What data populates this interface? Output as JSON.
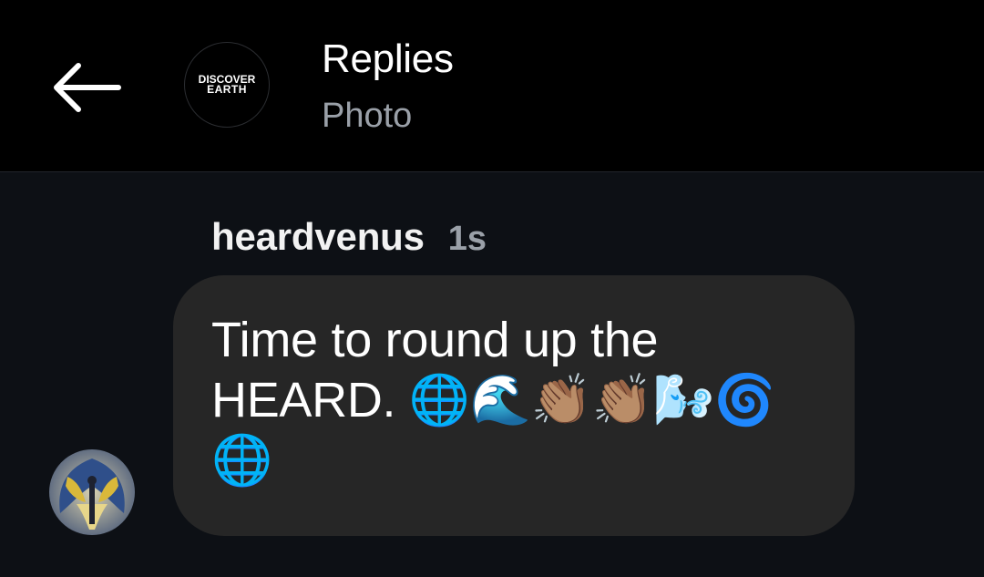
{
  "header": {
    "title": "Replies",
    "subtitle": "Photo",
    "account_logo": {
      "line1": "DISCOVER",
      "line2": "EARTH"
    }
  },
  "reply": {
    "username": "heardvenus",
    "timestamp": "1s",
    "message": "Time to round up the HEARD. 🌐🌊👏🏽👏🏽🌬️🌀🌐"
  },
  "colors": {
    "header_bg": "#000000",
    "body_bg": "#0d1015",
    "bubble_bg": "#262626",
    "primary_text": "#ffffff",
    "secondary_text": "#9aa0a8"
  },
  "icons": [
    "arrow-left-icon"
  ]
}
